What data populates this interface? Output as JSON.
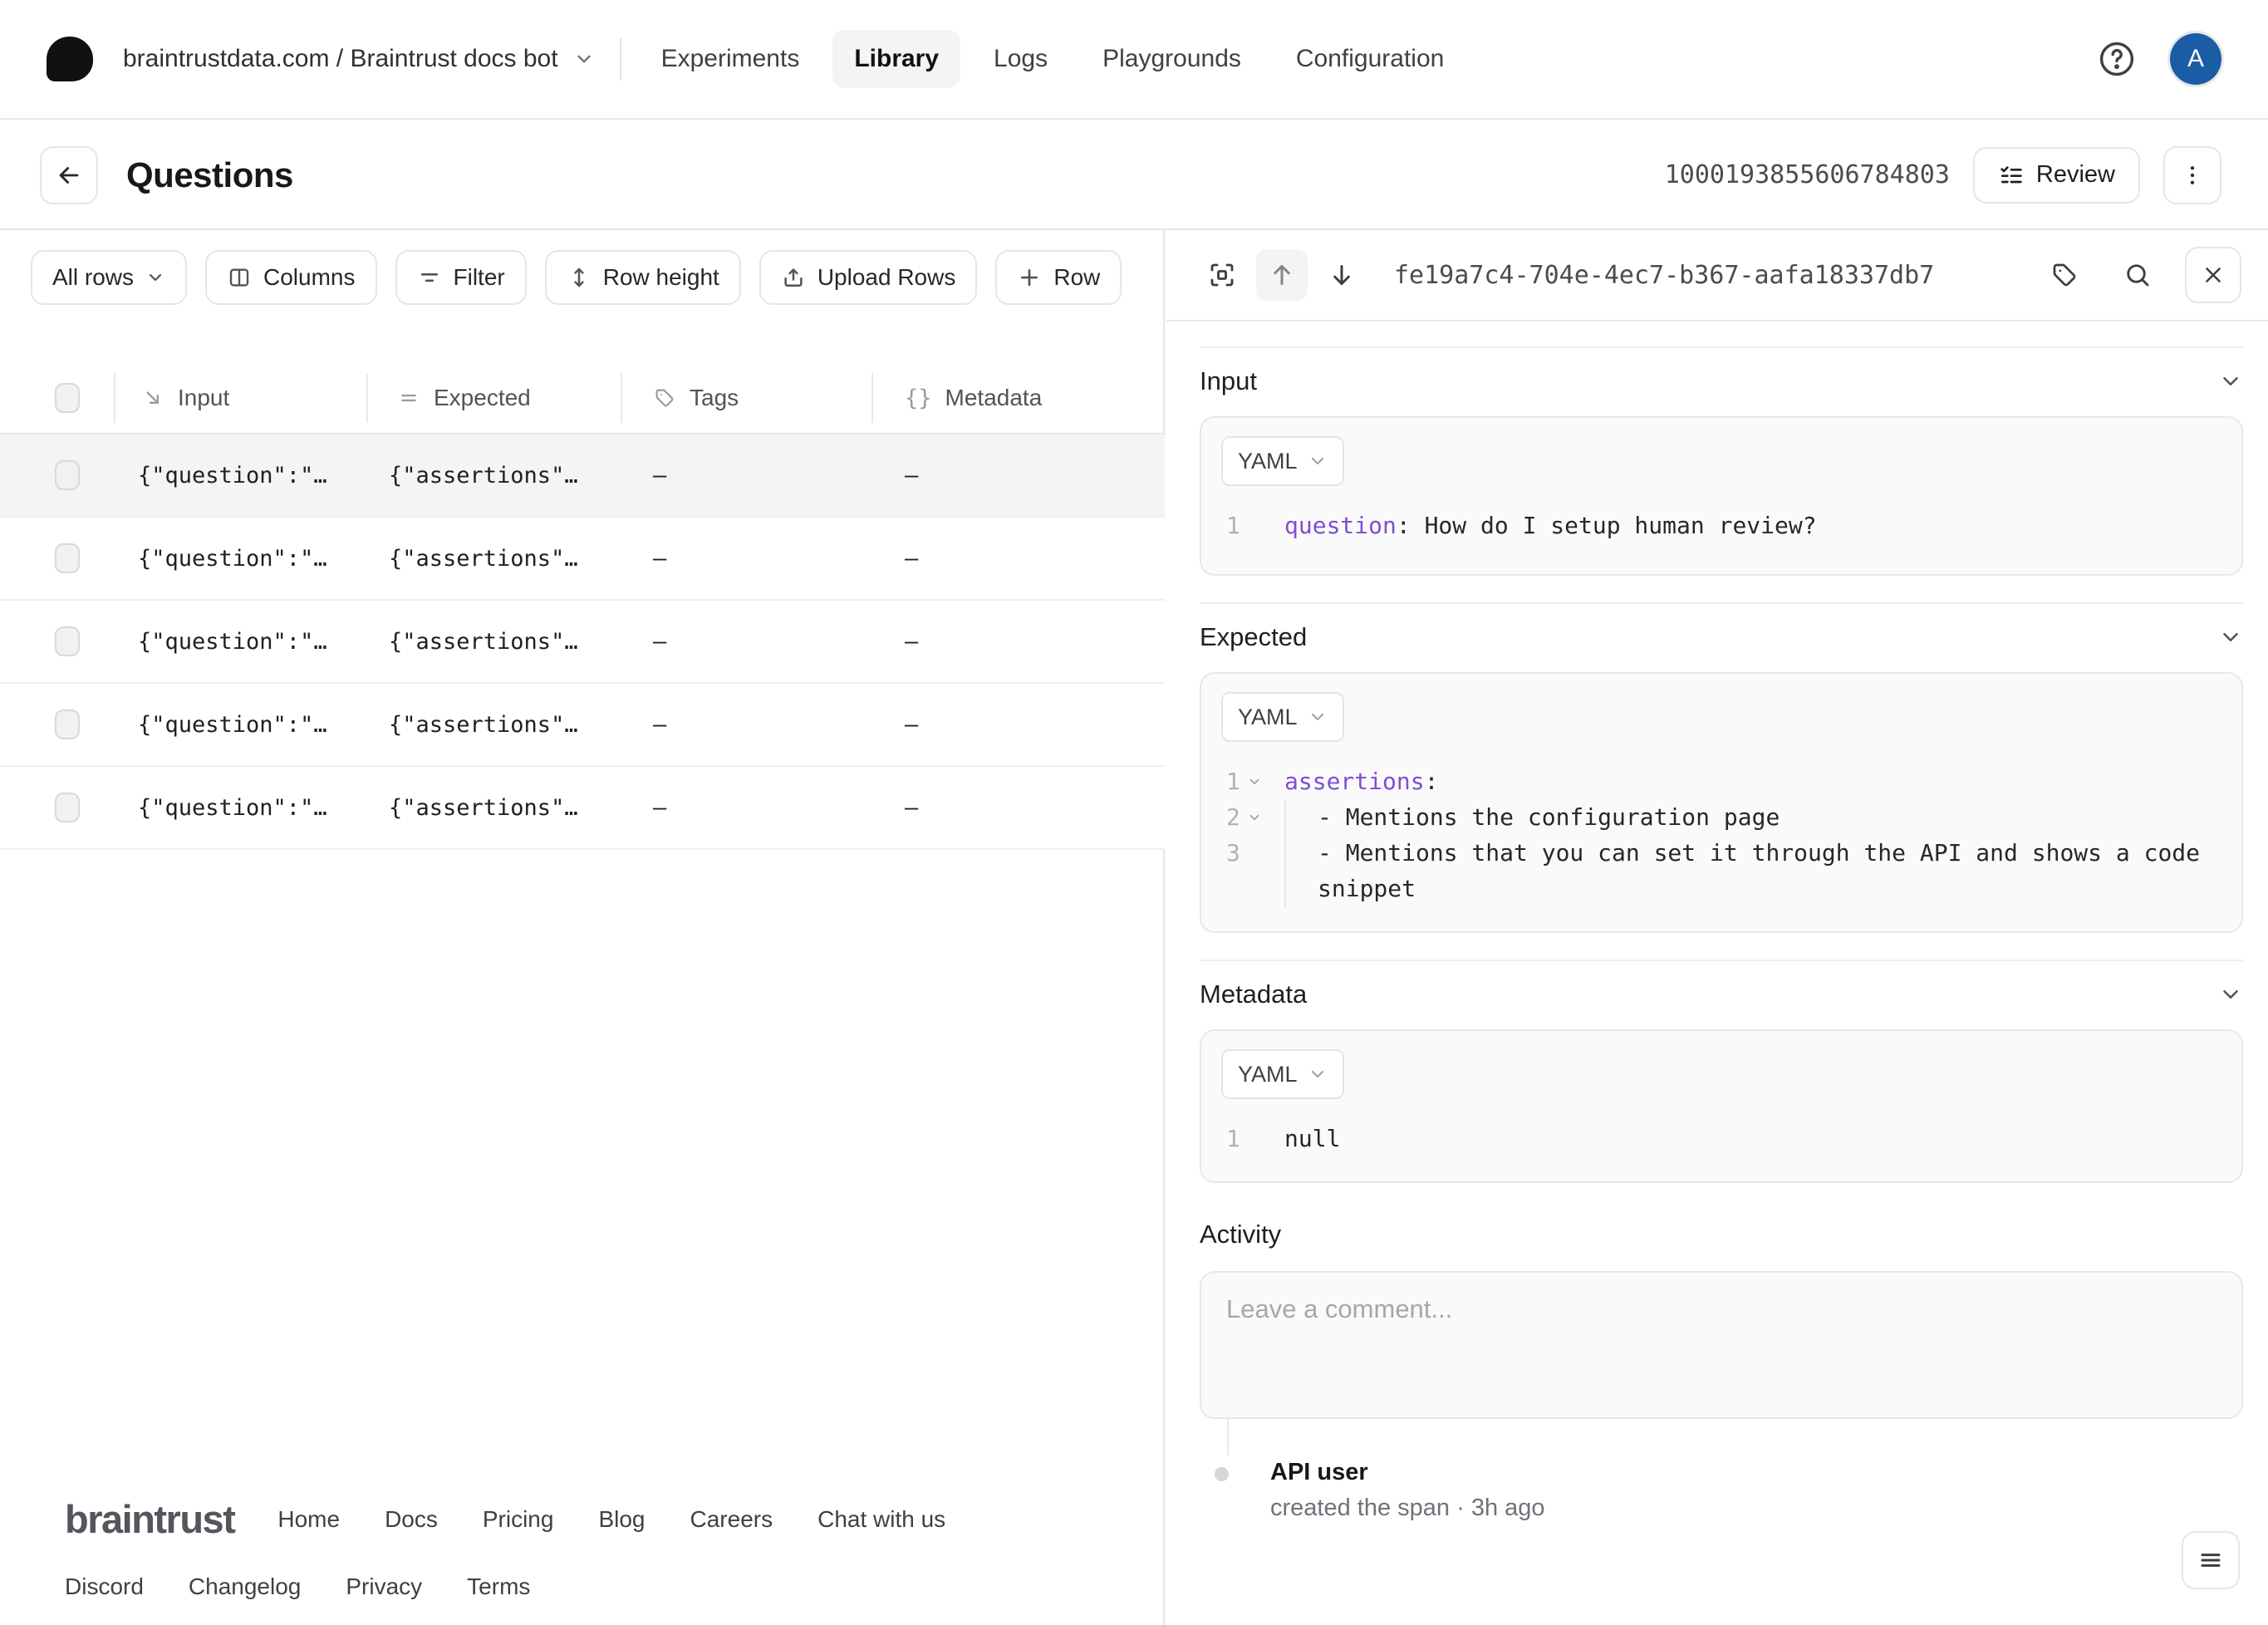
{
  "nav": {
    "breadcrumb": "braintrustdata.com / Braintrust docs bot",
    "tabs": [
      "Experiments",
      "Library",
      "Logs",
      "Playgrounds",
      "Configuration"
    ],
    "active_tab": "Library",
    "avatar_letter": "A"
  },
  "header": {
    "title": "Questions",
    "dataset_id": "1000193855606784803",
    "review_label": "Review"
  },
  "toolbar": {
    "rows_filter": "All rows",
    "columns": "Columns",
    "filter": "Filter",
    "row_height": "Row height",
    "upload_rows": "Upload Rows",
    "add_row": "Row"
  },
  "table": {
    "columns": {
      "input": "Input",
      "expected": "Expected",
      "tags": "Tags",
      "metadata": "Metadata"
    },
    "rows": [
      {
        "input": "{\"question\":\"…",
        "expected": "{\"assertions\"…",
        "tags": "–",
        "metadata": "–",
        "selected": true
      },
      {
        "input": "{\"question\":\"…",
        "expected": "{\"assertions\"…",
        "tags": "–",
        "metadata": "–",
        "selected": false
      },
      {
        "input": "{\"question\":\"…",
        "expected": "{\"assertions\"…",
        "tags": "–",
        "metadata": "–",
        "selected": false
      },
      {
        "input": "{\"question\":\"…",
        "expected": "{\"assertions\"…",
        "tags": "–",
        "metadata": "–",
        "selected": false
      },
      {
        "input": "{\"question\":\"…",
        "expected": "{\"assertions\"…",
        "tags": "–",
        "metadata": "–",
        "selected": false
      }
    ]
  },
  "panel": {
    "span_id": "fe19a7c4-704e-4ec7-b367-aafa18337db7",
    "sections": {
      "input": {
        "title": "Input",
        "format": "YAML"
      },
      "expected": {
        "title": "Expected",
        "format": "YAML"
      },
      "metadata": {
        "title": "Metadata",
        "format": "YAML"
      }
    },
    "code": {
      "input": {
        "l1_no": "1",
        "l1_key": "question",
        "l1_rest": ": How do I setup human review?"
      },
      "expected": {
        "l1_no": "1",
        "l1_key": "assertions",
        "l1_rest": ":",
        "l2_no": "2",
        "l2_text": "- Mentions the configuration page",
        "l3_no": "3",
        "l3_text": "- Mentions that you can set it through the API and shows a code snippet"
      },
      "metadata": {
        "l1_no": "1",
        "l1_text": "null"
      }
    },
    "activity": {
      "title": "Activity",
      "placeholder": "Leave a comment...",
      "event_user": "API user",
      "event_desc": "created the span · 3h ago"
    }
  },
  "footer": {
    "brand": "braintrust",
    "links_row1": [
      "Home",
      "Docs",
      "Pricing",
      "Blog",
      "Careers",
      "Chat with us"
    ],
    "links_row2": [
      "Discord",
      "Changelog",
      "Privacy",
      "Terms"
    ]
  },
  "colors": {
    "avatar_blue": "#1b5da5",
    "yaml_key_purple": "#7d4fd3",
    "selected_row": "#f4f4f5"
  }
}
